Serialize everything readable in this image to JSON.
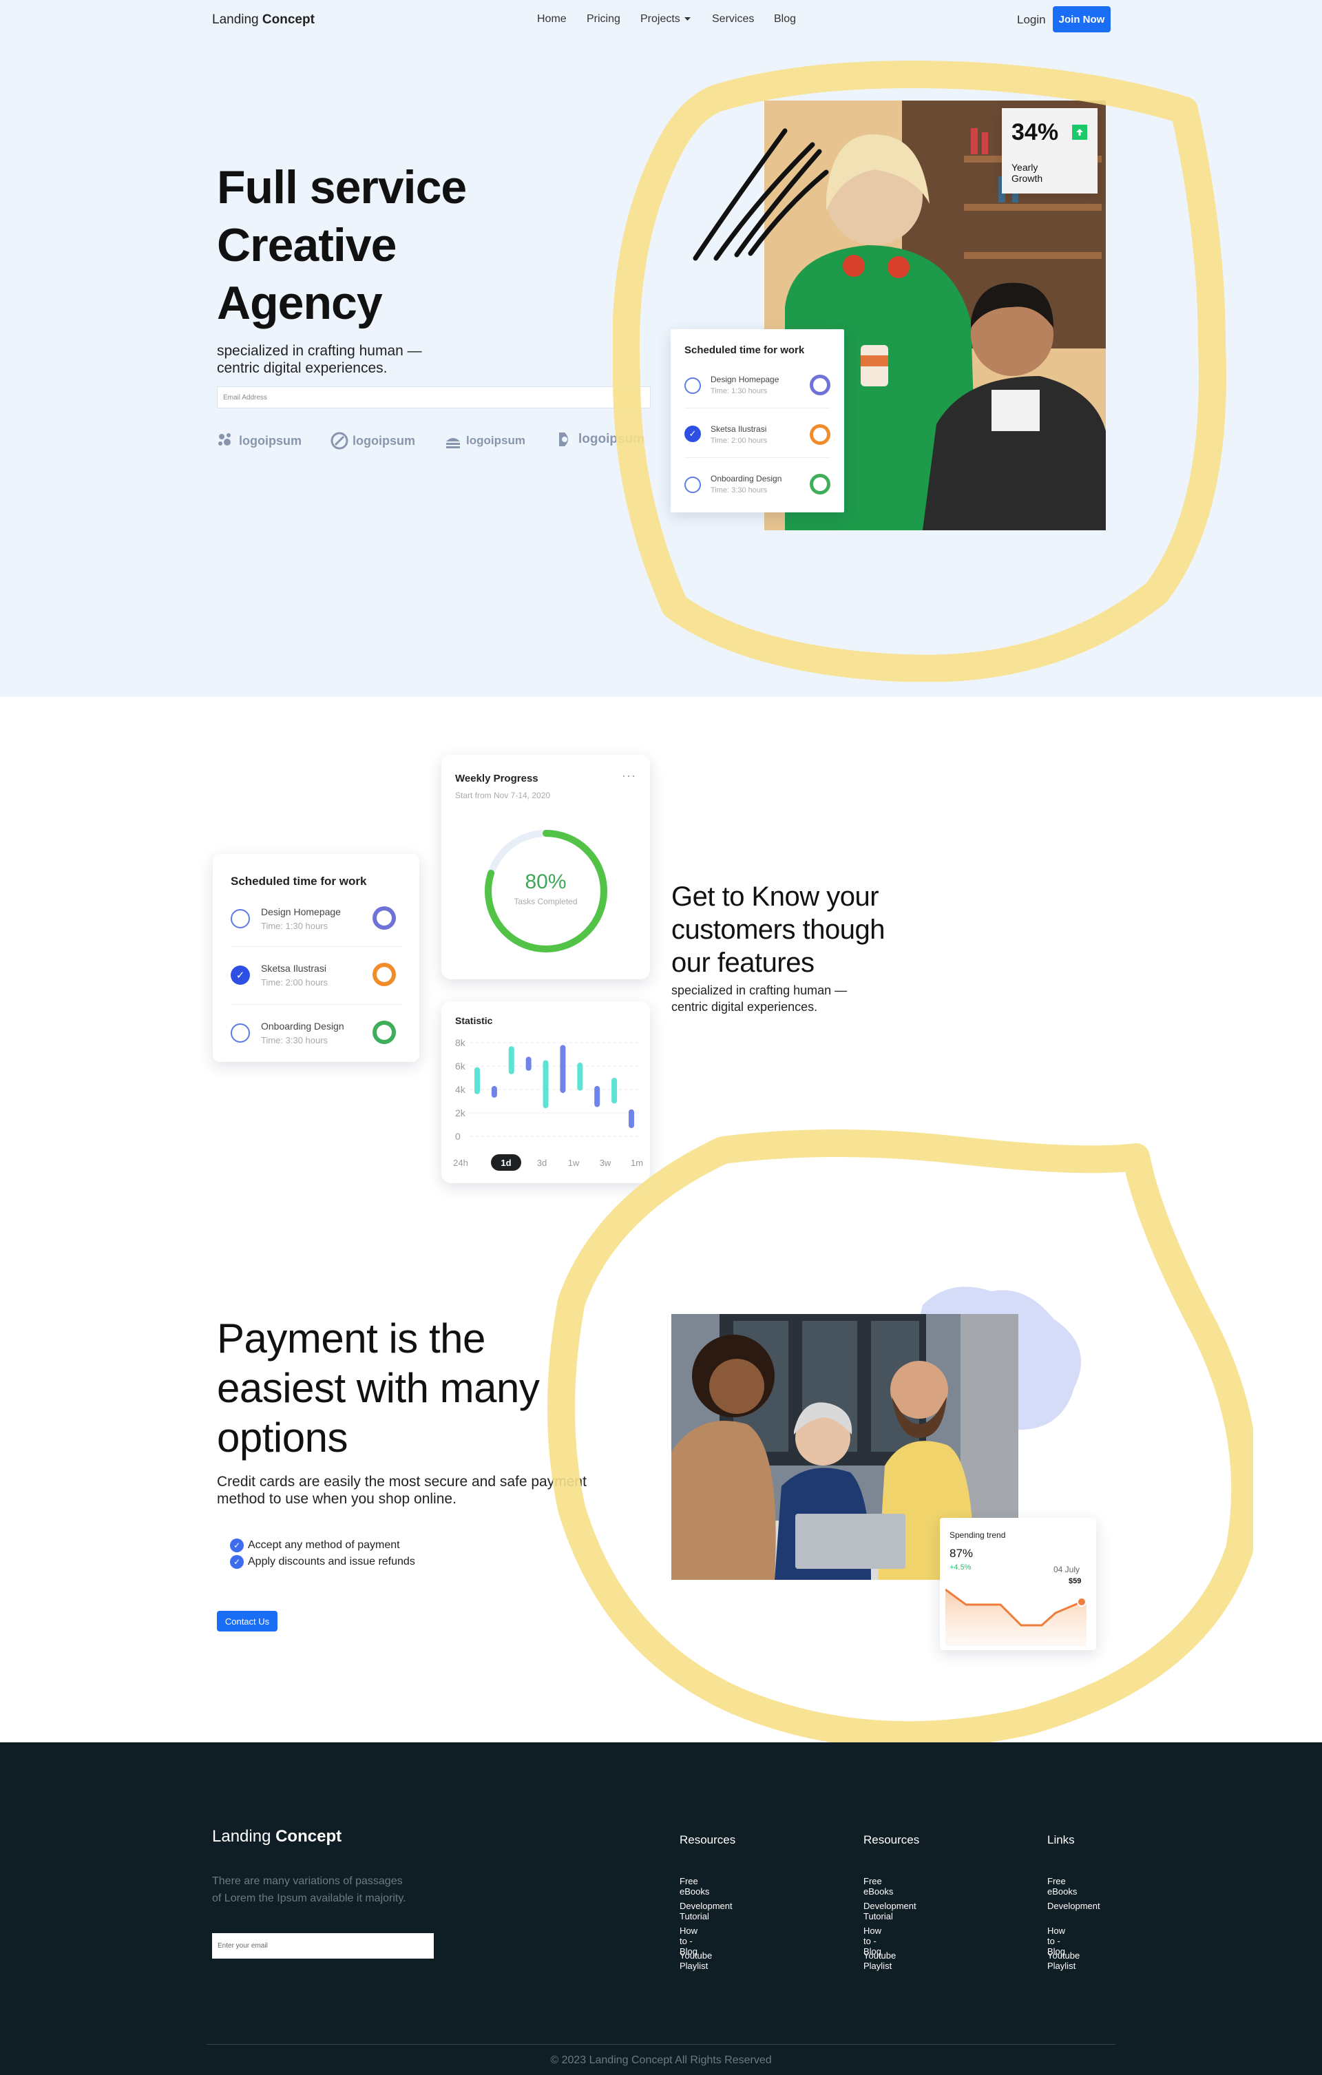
{
  "nav": {
    "brand_light": "Landing",
    "brand_bold": "Concept",
    "links": [
      "Home",
      "Pricing",
      "Projects",
      "Services",
      "Blog"
    ],
    "login": "Login",
    "join": "Join Now"
  },
  "hero": {
    "title_lines": [
      "Full service",
      "Creative",
      "Agency"
    ],
    "subtitle_lines": [
      "specialized in crafting human —",
      "centric digital experiences."
    ],
    "email_placeholder": "Email Address",
    "logos": [
      "logoipsum",
      "logoipsum",
      "logoipsum",
      "logoipsum"
    ],
    "growth_value": "34%",
    "growth_label_lines": [
      "Yearly",
      "Growth"
    ]
  },
  "schedule": {
    "title": "Scheduled time for work",
    "tasks": [
      {
        "name": "Design Homepage",
        "time": "Time: 1:30 hours",
        "done": false,
        "color": "#6f72d6"
      },
      {
        "name": "Sketsa Ilustrasi",
        "time": "Time: 2:00 hours",
        "done": true,
        "color": "#f08c2a"
      },
      {
        "name": "Onboarding Design",
        "time": "Time: 3:30 hours",
        "done": false,
        "color": "#3fae5a"
      }
    ]
  },
  "weekly": {
    "title": "Weekly Progress",
    "subtitle": "Start from Nov 7-14, 2020",
    "percent": "80%",
    "percent_value": 80,
    "caption": "Tasks Completed",
    "menu_icon": "ellipsis-icon"
  },
  "statistic": {
    "title": "Statistic",
    "tabs": [
      "24h",
      "1d",
      "3d",
      "1w",
      "3w",
      "1m"
    ],
    "active_tab": "1d"
  },
  "chart_data": {
    "type": "candlestick",
    "title": "Statistic",
    "ylim": [
      0,
      8000
    ],
    "y_ticks": [
      "8k",
      "6k",
      "4k",
      "2k",
      "0"
    ],
    "candles": [
      {
        "low": 3600,
        "high": 5900,
        "color": "#5de3d4"
      },
      {
        "low": 3300,
        "high": 4300,
        "color": "#6f83e8"
      },
      {
        "low": 5300,
        "high": 7700,
        "color": "#5de3d4"
      },
      {
        "low": 5600,
        "high": 6800,
        "color": "#6f83e8"
      },
      {
        "low": 2400,
        "high": 6500,
        "color": "#5de3d4"
      },
      {
        "low": 3700,
        "high": 7800,
        "color": "#6f83e8"
      },
      {
        "low": 3900,
        "high": 6300,
        "color": "#5de3d4"
      },
      {
        "low": 2500,
        "high": 4300,
        "color": "#6f83e8"
      },
      {
        "low": 2800,
        "high": 5000,
        "color": "#5de3d4"
      },
      {
        "low": 700,
        "high": 2300,
        "color": "#6f83e8"
      }
    ]
  },
  "features": {
    "title_lines": [
      "Get to Know your",
      "customers though",
      "our features"
    ],
    "subtitle_lines": [
      "specialized in crafting human —",
      "centric digital experiences."
    ]
  },
  "payment": {
    "title_lines": [
      "Payment is the",
      "easiest with many",
      "options"
    ],
    "subtitle_lines": [
      "Credit cards are easily the most secure and safe payment",
      "method to use when you shop online."
    ],
    "checks": [
      "Accept any method of payment",
      "Apply discounts and issue refunds"
    ],
    "cta": "Contact Us"
  },
  "spending": {
    "title": "Spending trend",
    "value": "87%",
    "change": "+4.5%",
    "date": "04 July",
    "amount": "$59"
  },
  "footer": {
    "brand_light": "Landing",
    "brand_bold": "Concept",
    "description_lines": [
      "There are many variations of passages",
      "of Lorem the Ipsum available it majority."
    ],
    "email_placeholder": "Enter your email",
    "columns": [
      {
        "heading": "Resources",
        "links": [
          "Free eBooks",
          "Development Tutorial",
          "How to - Blog",
          "Youtube Playlist"
        ]
      },
      {
        "heading": "Resources",
        "links": [
          "Free eBooks",
          "Development Tutorial",
          "How to - Blog",
          "Youtube Playlist"
        ]
      },
      {
        "heading": "Links",
        "links": [
          "Free eBooks",
          "Development",
          "How to - Blog",
          "Youtube Playlist"
        ]
      }
    ],
    "copyright": "© 2023 Landing Concept All Rights Reserved"
  },
  "colors": {
    "accent": "#1a6ef5",
    "hero_bg": "#eef4fc",
    "highlight": "#f7e08a",
    "footer_bg": "#0f1d24",
    "growth_green": "#19c96a"
  }
}
